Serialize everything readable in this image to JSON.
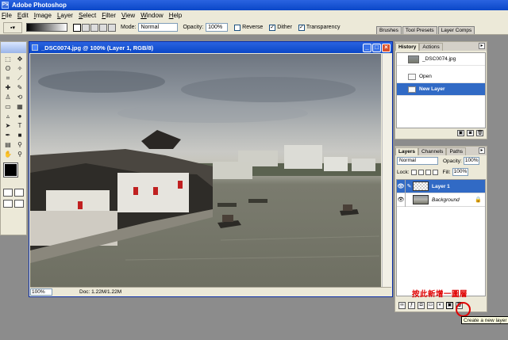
{
  "app": {
    "title": "Adobe Photoshop"
  },
  "menu": [
    "File",
    "Edit",
    "Image",
    "Layer",
    "Select",
    "Filter",
    "View",
    "Window",
    "Help"
  ],
  "options": {
    "mode_label": "Mode:",
    "mode_value": "Normal",
    "opacity_label": "Opacity:",
    "opacity_value": "100%",
    "reverse_label": "Reverse",
    "dither_label": "Dither",
    "transparency_label": "Transparency"
  },
  "well_tabs": [
    "Brushes",
    "Tool Presets",
    "Layer Comps"
  ],
  "document": {
    "title": "_DSC0074.jpg @ 100% (Layer 1, RGB/8)",
    "zoom": "100%",
    "doc_info": "Doc: 1.22M/1.22M"
  },
  "history": {
    "tabs": [
      "History",
      "Actions"
    ],
    "snapshot": "_DSC0074.jpg",
    "items": [
      {
        "label": "Open"
      },
      {
        "label": "New Layer"
      }
    ]
  },
  "layers": {
    "tabs": [
      "Layers",
      "Channels",
      "Paths"
    ],
    "blend_mode": "Normal",
    "opacity_label": "Opacity:",
    "opacity_value": "100%",
    "lock_label": "Lock:",
    "fill_label": "Fill:",
    "fill_value": "100%",
    "items": [
      {
        "name": "Layer 1"
      },
      {
        "name": "Background"
      }
    ]
  },
  "annotation": {
    "text": "按此新增一圖層",
    "tooltip": "Create a new layer"
  },
  "colors": {
    "title_blue": "#0a47c8",
    "selection_blue": "#316ac5",
    "annotation_red": "#e00000"
  }
}
